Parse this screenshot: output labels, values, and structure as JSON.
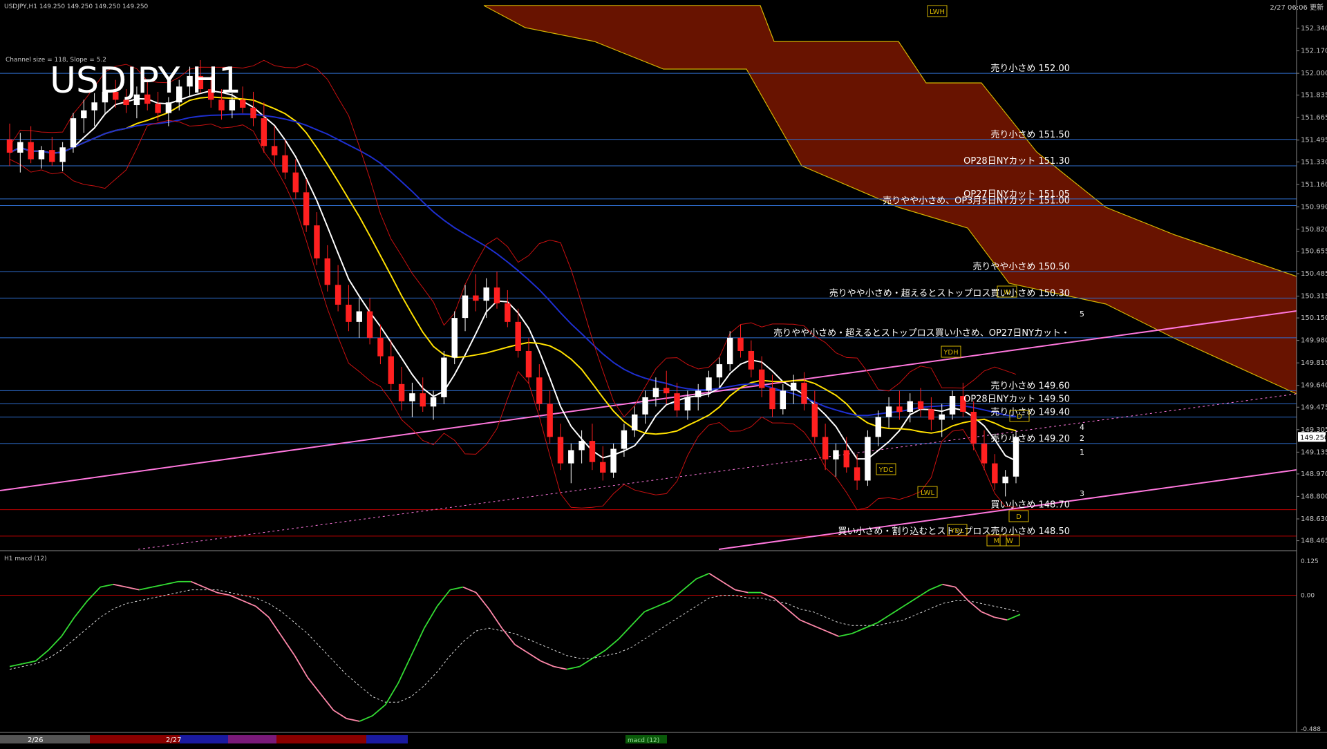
{
  "header": {
    "symbol_info": "USDJPY,H1  149.250 149.250 149.250 149.250",
    "timestamp": "2/27 06:06 更新",
    "big_title": "USDJPY H1",
    "channel_info": "Channel size = 118, Slope = 5.2"
  },
  "colors": {
    "background": "#000000",
    "bull_candle": "#ffffff",
    "bear_candle": "#ff2020",
    "level_line": "#2f6fd1",
    "red_level": "#c00000",
    "cloud": "#8b1a00",
    "cloud_edge": "#d4b400",
    "channel": "#ff77dd",
    "ma_fast": "#ffffff",
    "ma_slow": "#ffe000",
    "ma_long": "#1e2fd0",
    "bollinger": "#c81010",
    "macd_up": "#33dd33",
    "macd_down": "#ff88aa",
    "macd_signal": "#dddddd"
  },
  "chart_data": [
    {
      "type": "candlestick",
      "title": "USDJPY H1",
      "ylim": [
        148.4,
        152.45
      ],
      "y_ticks": [
        "152.340",
        "152.170",
        "152.000",
        "151.835",
        "151.665",
        "151.495",
        "151.330",
        "151.160",
        "150.990",
        "150.820",
        "150.655",
        "150.485",
        "150.315",
        "150.150",
        "149.980",
        "149.810",
        "149.640",
        "149.475",
        "149.305",
        "149.135",
        "148.970",
        "148.800",
        "148.630",
        "148.465"
      ],
      "current_price": "149.250",
      "x_labels": [
        "2/26",
        "2/27"
      ],
      "levels": [
        {
          "price": 152.0,
          "label": "売り小さめ 152.00"
        },
        {
          "price": 151.5,
          "label": "売り小さめ 151.50"
        },
        {
          "price": 151.3,
          "label": "OP28日NYカット 151.30"
        },
        {
          "price": 151.05,
          "label": "OP27日NYカット 151.05"
        },
        {
          "price": 151.0,
          "label": "売りやや小さめ、OP3月5日NYカット 151.00"
        },
        {
          "price": 150.5,
          "label": "売りやや小さめ 150.50"
        },
        {
          "price": 150.3,
          "label": "売りやや小さめ・超えるとストップロス買い小さめ 150.30"
        },
        {
          "price": 150.0,
          "label": "売りやや小さめ・超えるとストップロス買い小さめ、OP27日NYカット・"
        },
        {
          "price": 149.6,
          "label": "売り小さめ 149.60"
        },
        {
          "price": 149.5,
          "label": "OP28日NYカット 149.50"
        },
        {
          "price": 149.4,
          "label": "売り小さめ 149.40"
        },
        {
          "price": 149.2,
          "label": "売り小さめ 149.20"
        },
        {
          "price": 148.7,
          "label": "買い小さめ 148.70"
        },
        {
          "price": 148.5,
          "label": "買い小さめ・割り込むとストップロス売り小さめ 148.50"
        }
      ],
      "markers": [
        "LWH",
        "YDH",
        "YDC",
        "LWL",
        "YDL",
        "W",
        "D",
        "M",
        "W",
        "D"
      ],
      "projection_labels": [
        "5",
        "4",
        "2",
        "1",
        "3"
      ],
      "candles": [
        [
          151.5,
          151.62,
          151.3,
          151.4
        ],
        [
          151.4,
          151.55,
          151.25,
          151.48
        ],
        [
          151.48,
          151.6,
          151.32,
          151.35
        ],
        [
          151.35,
          151.45,
          151.28,
          151.42
        ],
        [
          151.42,
          151.52,
          151.3,
          151.33
        ],
        [
          151.33,
          151.48,
          151.26,
          151.44
        ],
        [
          151.44,
          151.7,
          151.4,
          151.66
        ],
        [
          151.66,
          151.8,
          151.55,
          151.72
        ],
        [
          151.72,
          151.85,
          151.6,
          151.78
        ],
        [
          151.78,
          151.92,
          151.7,
          151.86
        ],
        [
          151.86,
          151.95,
          151.74,
          151.8
        ],
        [
          151.8,
          151.88,
          151.7,
          151.76
        ],
        [
          151.76,
          151.9,
          151.66,
          151.84
        ],
        [
          151.84,
          151.94,
          151.72,
          151.77
        ],
        [
          151.77,
          151.86,
          151.64,
          151.7
        ],
        [
          151.7,
          151.82,
          151.6,
          151.78
        ],
        [
          151.78,
          151.95,
          151.72,
          151.9
        ],
        [
          151.9,
          152.05,
          151.82,
          151.98
        ],
        [
          151.98,
          152.1,
          151.85,
          151.88
        ],
        [
          151.88,
          151.98,
          151.74,
          151.8
        ],
        [
          151.8,
          151.88,
          151.65,
          151.72
        ],
        [
          151.72,
          151.85,
          151.66,
          151.8
        ],
        [
          151.8,
          151.9,
          151.7,
          151.74
        ],
        [
          151.74,
          151.86,
          151.6,
          151.66
        ],
        [
          151.66,
          151.78,
          151.4,
          151.45
        ],
        [
          151.45,
          151.6,
          151.3,
          151.38
        ],
        [
          151.38,
          151.5,
          151.2,
          151.25
        ],
        [
          151.25,
          151.35,
          151.05,
          151.1
        ],
        [
          151.1,
          151.2,
          150.8,
          150.85
        ],
        [
          150.85,
          150.95,
          150.55,
          150.6
        ],
        [
          150.6,
          150.7,
          150.35,
          150.4
        ],
        [
          150.4,
          150.55,
          150.2,
          150.25
        ],
        [
          150.25,
          150.4,
          150.05,
          150.12
        ],
        [
          150.12,
          150.3,
          150.0,
          150.2
        ],
        [
          150.2,
          150.3,
          149.95,
          150.0
        ],
        [
          150.0,
          150.1,
          149.8,
          149.86
        ],
        [
          149.86,
          149.98,
          149.6,
          149.65
        ],
        [
          149.65,
          149.78,
          149.45,
          149.52
        ],
        [
          149.52,
          149.66,
          149.4,
          149.58
        ],
        [
          149.58,
          149.7,
          149.44,
          149.48
        ],
        [
          149.48,
          149.6,
          149.38,
          149.55
        ],
        [
          149.55,
          149.9,
          149.5,
          149.85
        ],
        [
          149.85,
          150.2,
          149.8,
          150.15
        ],
        [
          150.15,
          150.4,
          150.05,
          150.32
        ],
        [
          150.32,
          150.48,
          150.2,
          150.28
        ],
        [
          150.28,
          150.45,
          150.15,
          150.38
        ],
        [
          150.38,
          150.5,
          150.22,
          150.26
        ],
        [
          150.26,
          150.36,
          150.08,
          150.12
        ],
        [
          150.12,
          150.22,
          149.85,
          149.9
        ],
        [
          149.9,
          150.0,
          149.65,
          149.7
        ],
        [
          149.7,
          149.8,
          149.45,
          149.5
        ],
        [
          149.5,
          149.6,
          149.2,
          149.25
        ],
        [
          149.25,
          149.35,
          149.0,
          149.05
        ],
        [
          149.05,
          149.2,
          148.9,
          149.15
        ],
        [
          149.15,
          149.3,
          149.05,
          149.22
        ],
        [
          149.22,
          149.35,
          149.0,
          149.06
        ],
        [
          149.06,
          149.18,
          148.92,
          148.98
        ],
        [
          148.98,
          149.2,
          148.94,
          149.16
        ],
        [
          149.16,
          149.35,
          149.1,
          149.3
        ],
        [
          149.3,
          149.48,
          149.25,
          149.42
        ],
        [
          149.42,
          149.6,
          149.35,
          149.55
        ],
        [
          149.55,
          149.7,
          149.48,
          149.62
        ],
        [
          149.62,
          149.75,
          149.5,
          149.58
        ],
        [
          149.58,
          149.66,
          149.4,
          149.45
        ],
        [
          149.45,
          149.6,
          149.38,
          149.55
        ],
        [
          149.55,
          149.65,
          149.45,
          149.6
        ],
        [
          149.6,
          149.75,
          149.55,
          149.7
        ],
        [
          149.7,
          149.85,
          149.62,
          149.8
        ],
        [
          149.8,
          150.05,
          149.75,
          150.0
        ],
        [
          150.0,
          150.1,
          149.85,
          149.9
        ],
        [
          149.9,
          149.98,
          149.7,
          149.76
        ],
        [
          149.76,
          149.86,
          149.55,
          149.62
        ],
        [
          149.62,
          149.72,
          149.4,
          149.46
        ],
        [
          149.46,
          149.65,
          149.42,
          149.6
        ],
        [
          149.6,
          149.72,
          149.5,
          149.66
        ],
        [
          149.66,
          149.74,
          149.45,
          149.5
        ],
        [
          149.5,
          149.6,
          149.2,
          149.25
        ],
        [
          149.25,
          149.35,
          149.0,
          149.08
        ],
        [
          149.08,
          149.2,
          148.95,
          149.15
        ],
        [
          149.15,
          149.25,
          148.98,
          149.02
        ],
        [
          149.02,
          149.12,
          148.85,
          148.92
        ],
        [
          148.92,
          149.3,
          148.88,
          149.25
        ],
        [
          149.25,
          149.45,
          149.18,
          149.4
        ],
        [
          149.4,
          149.55,
          149.32,
          149.48
        ],
        [
          149.48,
          149.6,
          149.38,
          149.44
        ],
        [
          149.44,
          149.58,
          149.36,
          149.52
        ],
        [
          149.52,
          149.62,
          149.4,
          149.46
        ],
        [
          149.46,
          149.55,
          149.3,
          149.38
        ],
        [
          149.38,
          149.5,
          149.25,
          149.42
        ],
        [
          149.42,
          149.6,
          149.38,
          149.56
        ],
        [
          149.56,
          149.66,
          149.4,
          149.44
        ],
        [
          149.44,
          149.52,
          149.15,
          149.2
        ],
        [
          149.2,
          149.3,
          149.0,
          149.05
        ],
        [
          149.05,
          149.12,
          148.85,
          148.9
        ],
        [
          148.9,
          149.0,
          148.8,
          148.95
        ],
        [
          148.95,
          149.3,
          148.9,
          149.25
        ]
      ]
    },
    {
      "type": "line",
      "title": "H1 macd (12)",
      "ylim": [
        -0.488,
        0.125
      ],
      "y_ticks": [
        "0.125",
        "0.00",
        "-0.488"
      ],
      "series": [
        {
          "name": "macd",
          "values": [
            -0.26,
            -0.25,
            -0.24,
            -0.2,
            -0.15,
            -0.08,
            -0.02,
            0.03,
            0.04,
            0.03,
            0.02,
            0.03,
            0.04,
            0.05,
            0.05,
            0.03,
            0.01,
            0.0,
            -0.02,
            -0.04,
            -0.08,
            -0.15,
            -0.22,
            -0.3,
            -0.36,
            -0.42,
            -0.45,
            -0.46,
            -0.44,
            -0.4,
            -0.32,
            -0.22,
            -0.12,
            -0.04,
            0.02,
            0.03,
            0.01,
            -0.05,
            -0.12,
            -0.18,
            -0.21,
            -0.24,
            -0.26,
            -0.27,
            -0.26,
            -0.23,
            -0.2,
            -0.16,
            -0.11,
            -0.06,
            -0.04,
            -0.02,
            0.02,
            0.06,
            0.08,
            0.05,
            0.02,
            0.01,
            0.01,
            -0.01,
            -0.05,
            -0.09,
            -0.11,
            -0.13,
            -0.15,
            -0.14,
            -0.12,
            -0.1,
            -0.07,
            -0.04,
            -0.01,
            0.02,
            0.04,
            0.03,
            -0.02,
            -0.06,
            -0.08,
            -0.09,
            -0.07
          ]
        },
        {
          "name": "signal",
          "values": [
            -0.27,
            -0.26,
            -0.25,
            -0.23,
            -0.2,
            -0.16,
            -0.12,
            -0.08,
            -0.05,
            -0.03,
            -0.02,
            -0.01,
            0.0,
            0.01,
            0.02,
            0.02,
            0.02,
            0.01,
            0.0,
            -0.01,
            -0.03,
            -0.06,
            -0.1,
            -0.14,
            -0.19,
            -0.24,
            -0.29,
            -0.33,
            -0.37,
            -0.39,
            -0.39,
            -0.37,
            -0.33,
            -0.28,
            -0.22,
            -0.17,
            -0.13,
            -0.12,
            -0.13,
            -0.14,
            -0.16,
            -0.18,
            -0.2,
            -0.22,
            -0.23,
            -0.23,
            -0.22,
            -0.21,
            -0.19,
            -0.16,
            -0.13,
            -0.1,
            -0.07,
            -0.04,
            -0.01,
            0.0,
            0.0,
            -0.01,
            -0.01,
            -0.02,
            -0.03,
            -0.05,
            -0.06,
            -0.08,
            -0.1,
            -0.11,
            -0.11,
            -0.11,
            -0.1,
            -0.09,
            -0.07,
            -0.05,
            -0.03,
            -0.02,
            -0.02,
            -0.03,
            -0.04,
            -0.05,
            -0.06
          ]
        }
      ]
    }
  ],
  "bottom_bar": {
    "date_labels": [
      "2/26",
      "2/27"
    ],
    "indicator_tag": "macd (12)"
  }
}
